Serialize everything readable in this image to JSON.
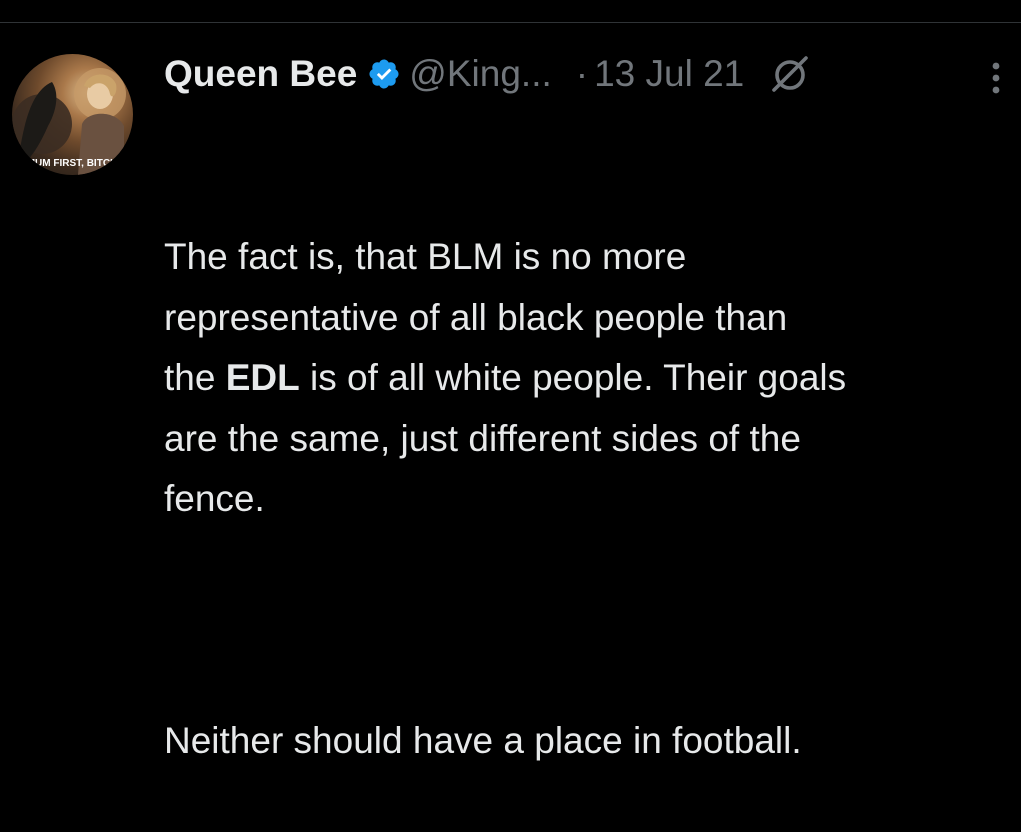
{
  "author": {
    "display_name": "Queen Bee",
    "handle": "@King...",
    "verified": true,
    "verified_color": "#1d9bf0",
    "avatar_caption": "MUM FIRST, BITCH"
  },
  "tweet": {
    "separator": "·",
    "date": "13 Jul 21",
    "paragraph1_part1": "The fact is, that BLM is no more\nrepresentative of all black people than\nthe ",
    "paragraph1_bold": "EDL",
    "paragraph1_part2": " is of all white people. Their goals\nare the same, just different sides of the\nfence.",
    "paragraph2": "Neither should have a place in football."
  },
  "icons": {
    "verified": "verified-badge-icon",
    "grok": "grok-icon",
    "more": "more-vertical-icon"
  },
  "colors": {
    "background": "#000000",
    "text": "#e7e9ea",
    "secondary_text": "#71767b",
    "divider": "#2f3336"
  }
}
